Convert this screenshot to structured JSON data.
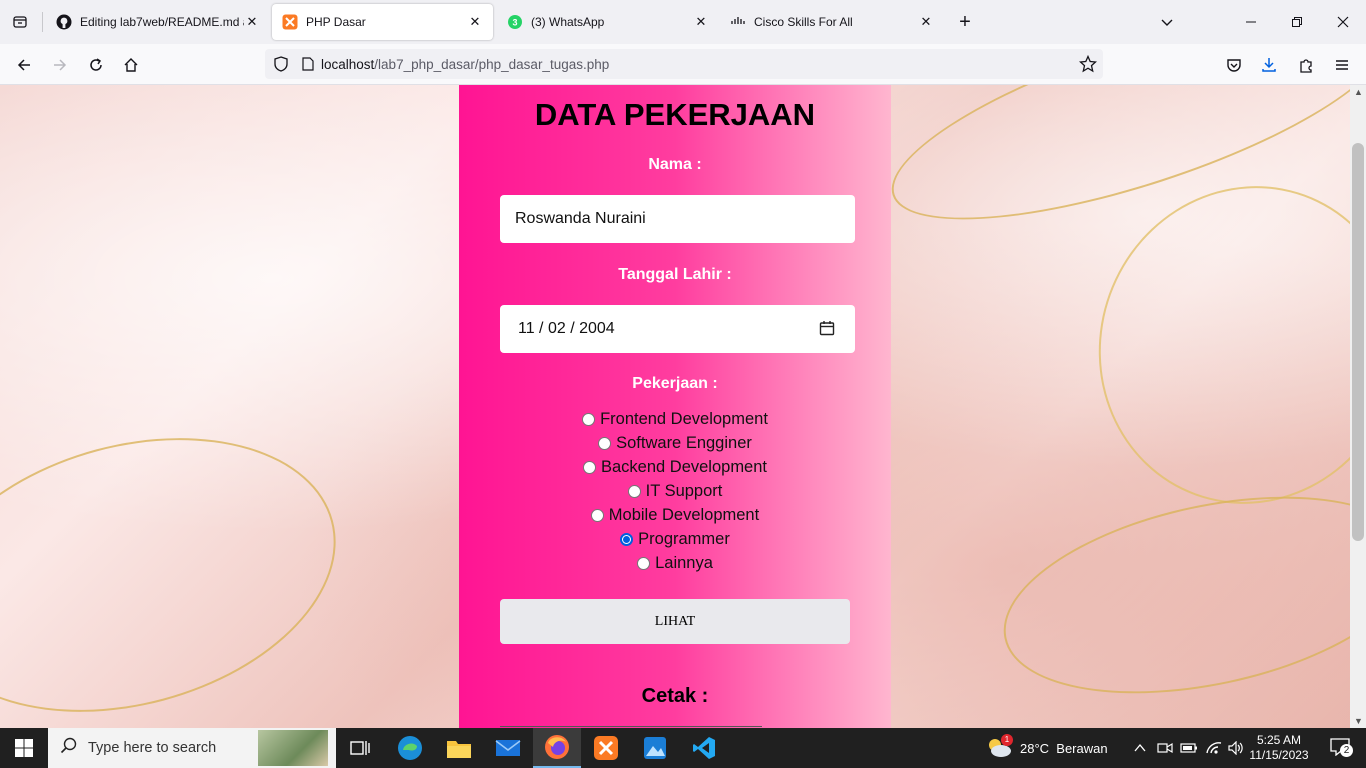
{
  "browser": {
    "tabs": [
      {
        "title": "Editing lab7web/README.md at",
        "icon": "github-icon",
        "active": false
      },
      {
        "title": "PHP Dasar",
        "icon": "xampp-icon",
        "active": true
      },
      {
        "title": "(3) WhatsApp",
        "icon": "whatsapp-icon",
        "active": false
      },
      {
        "title": "Cisco Skills For All",
        "icon": "cisco-icon",
        "active": false
      }
    ],
    "url_host": "localhost",
    "url_path": "/lab7_php_dasar/php_dasar_tugas.php"
  },
  "form": {
    "title": "DATA PEKERJAAN",
    "nama_label": "Nama :",
    "nama_value": "Roswanda Nuraini",
    "tgl_label": "Tanggal Lahir :",
    "tgl_value": "11 / 02 / 2004",
    "pekerjaan_label": "Pekerjaan :",
    "options": [
      "Frontend Development",
      "Software Engginer",
      "Backend Development",
      "IT Support",
      "Mobile Development",
      "Programmer",
      "Lainnya"
    ],
    "selected": "Programmer",
    "submit_label": "LIHAT",
    "cetak_label": "Cetak :"
  },
  "taskbar": {
    "search_placeholder": "Type here to search",
    "weather": "28°C  Berawan",
    "time": "5:25 AM",
    "date": "11/15/2023",
    "notifications": "2",
    "weather_badge": "1"
  }
}
